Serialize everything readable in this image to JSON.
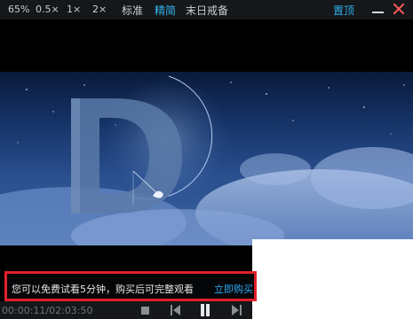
{
  "topbar": {
    "zoom_options": [
      "65%",
      "0.5×",
      "1×",
      "2×"
    ],
    "quality": {
      "standard": "标准",
      "hd": "精简"
    },
    "title": "末日戒备",
    "pin": "置顶"
  },
  "notice": {
    "text": "您可以免费试看5分钟，购买后可完整观看",
    "link": "立即购买"
  },
  "player": {
    "time": "00:00:11/02:03:50"
  },
  "colors": {
    "accent": "#34b5f0",
    "close": "#ff5a5a",
    "notice_border": "#e0202a"
  }
}
